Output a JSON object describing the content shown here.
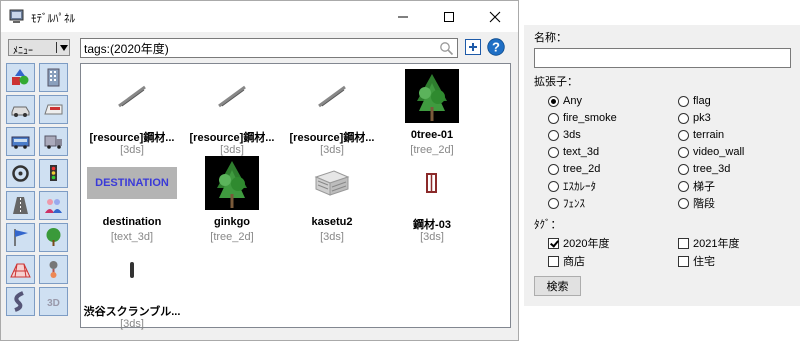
{
  "window": {
    "title": "ﾓﾃﾞﾙﾊﾟﾈﾙ"
  },
  "toolbar": {
    "menu_label": "ﾒﾆｭｰ",
    "search_value": "tags:(2020年度)",
    "search_icon": "search-icon",
    "add_icon": "plus-icon",
    "help_icon": "help-icon"
  },
  "categories": [
    {
      "icon": "shapes-icon"
    },
    {
      "icon": "building-icon"
    },
    {
      "icon": "car-icon"
    },
    {
      "icon": "train-icon"
    },
    {
      "icon": "bus-icon"
    },
    {
      "icon": "truck-icon"
    },
    {
      "icon": "vehicle-interior-icon"
    },
    {
      "icon": "traffic-light-icon"
    },
    {
      "icon": "road-icon"
    },
    {
      "icon": "people-icon"
    },
    {
      "icon": "flag-icon"
    },
    {
      "icon": "tree-icon"
    },
    {
      "icon": "terrain-grid-icon"
    },
    {
      "icon": "pin-icon"
    },
    {
      "icon": "curve-icon"
    },
    {
      "icon": "3d-icon"
    }
  ],
  "items": [
    {
      "name": "[resource]鋼材...",
      "type": "[3ds]",
      "thumb": "steel-bar"
    },
    {
      "name": "[resource]鋼材...",
      "type": "[3ds]",
      "thumb": "steel-bar"
    },
    {
      "name": "[resource]鋼材...",
      "type": "[3ds]",
      "thumb": "steel-bar"
    },
    {
      "name": "0tree-01",
      "type": "[tree_2d]",
      "thumb": "tree"
    },
    {
      "name": "destination",
      "type": "[text_3d]",
      "thumb": "text",
      "thumb_text": "DESTINATION"
    },
    {
      "name": "ginkgo",
      "type": "[tree_2d]",
      "thumb": "tree"
    },
    {
      "name": "kasetu2",
      "type": "[3ds]",
      "thumb": "building"
    },
    {
      "name": "鋼材-03",
      "type": "[3ds]",
      "thumb": "frame"
    },
    {
      "name": "渋谷スクランブル...",
      "type": "[3ds]",
      "thumb": "pole"
    }
  ],
  "search_panel": {
    "name_label": "名称：",
    "name_value": "",
    "ext_label": "拡張子：",
    "extensions_left": [
      {
        "label": "Any",
        "selected": true
      },
      {
        "label": "fire_smoke",
        "selected": false
      },
      {
        "label": "3ds",
        "selected": false
      },
      {
        "label": "text_3d",
        "selected": false
      },
      {
        "label": "tree_2d",
        "selected": false
      },
      {
        "label": "ｴｽｶﾚｰﾀ",
        "selected": false
      },
      {
        "label": "ﾌｪﾝｽ",
        "selected": false
      }
    ],
    "extensions_right": [
      {
        "label": "flag",
        "selected": false
      },
      {
        "label": "pk3",
        "selected": false
      },
      {
        "label": "terrain",
        "selected": false
      },
      {
        "label": "video_wall",
        "selected": false
      },
      {
        "label": "tree_3d",
        "selected": false
      },
      {
        "label": "梯子",
        "selected": false
      },
      {
        "label": "階段",
        "selected": false
      }
    ],
    "tag_label": "ﾀｸﾞ：",
    "tags": [
      {
        "label": "2020年度",
        "checked": true
      },
      {
        "label": "2021年度",
        "checked": false
      },
      {
        "label": "商店",
        "checked": false
      },
      {
        "label": "住宅",
        "checked": false
      }
    ],
    "search_button": "検索"
  }
}
